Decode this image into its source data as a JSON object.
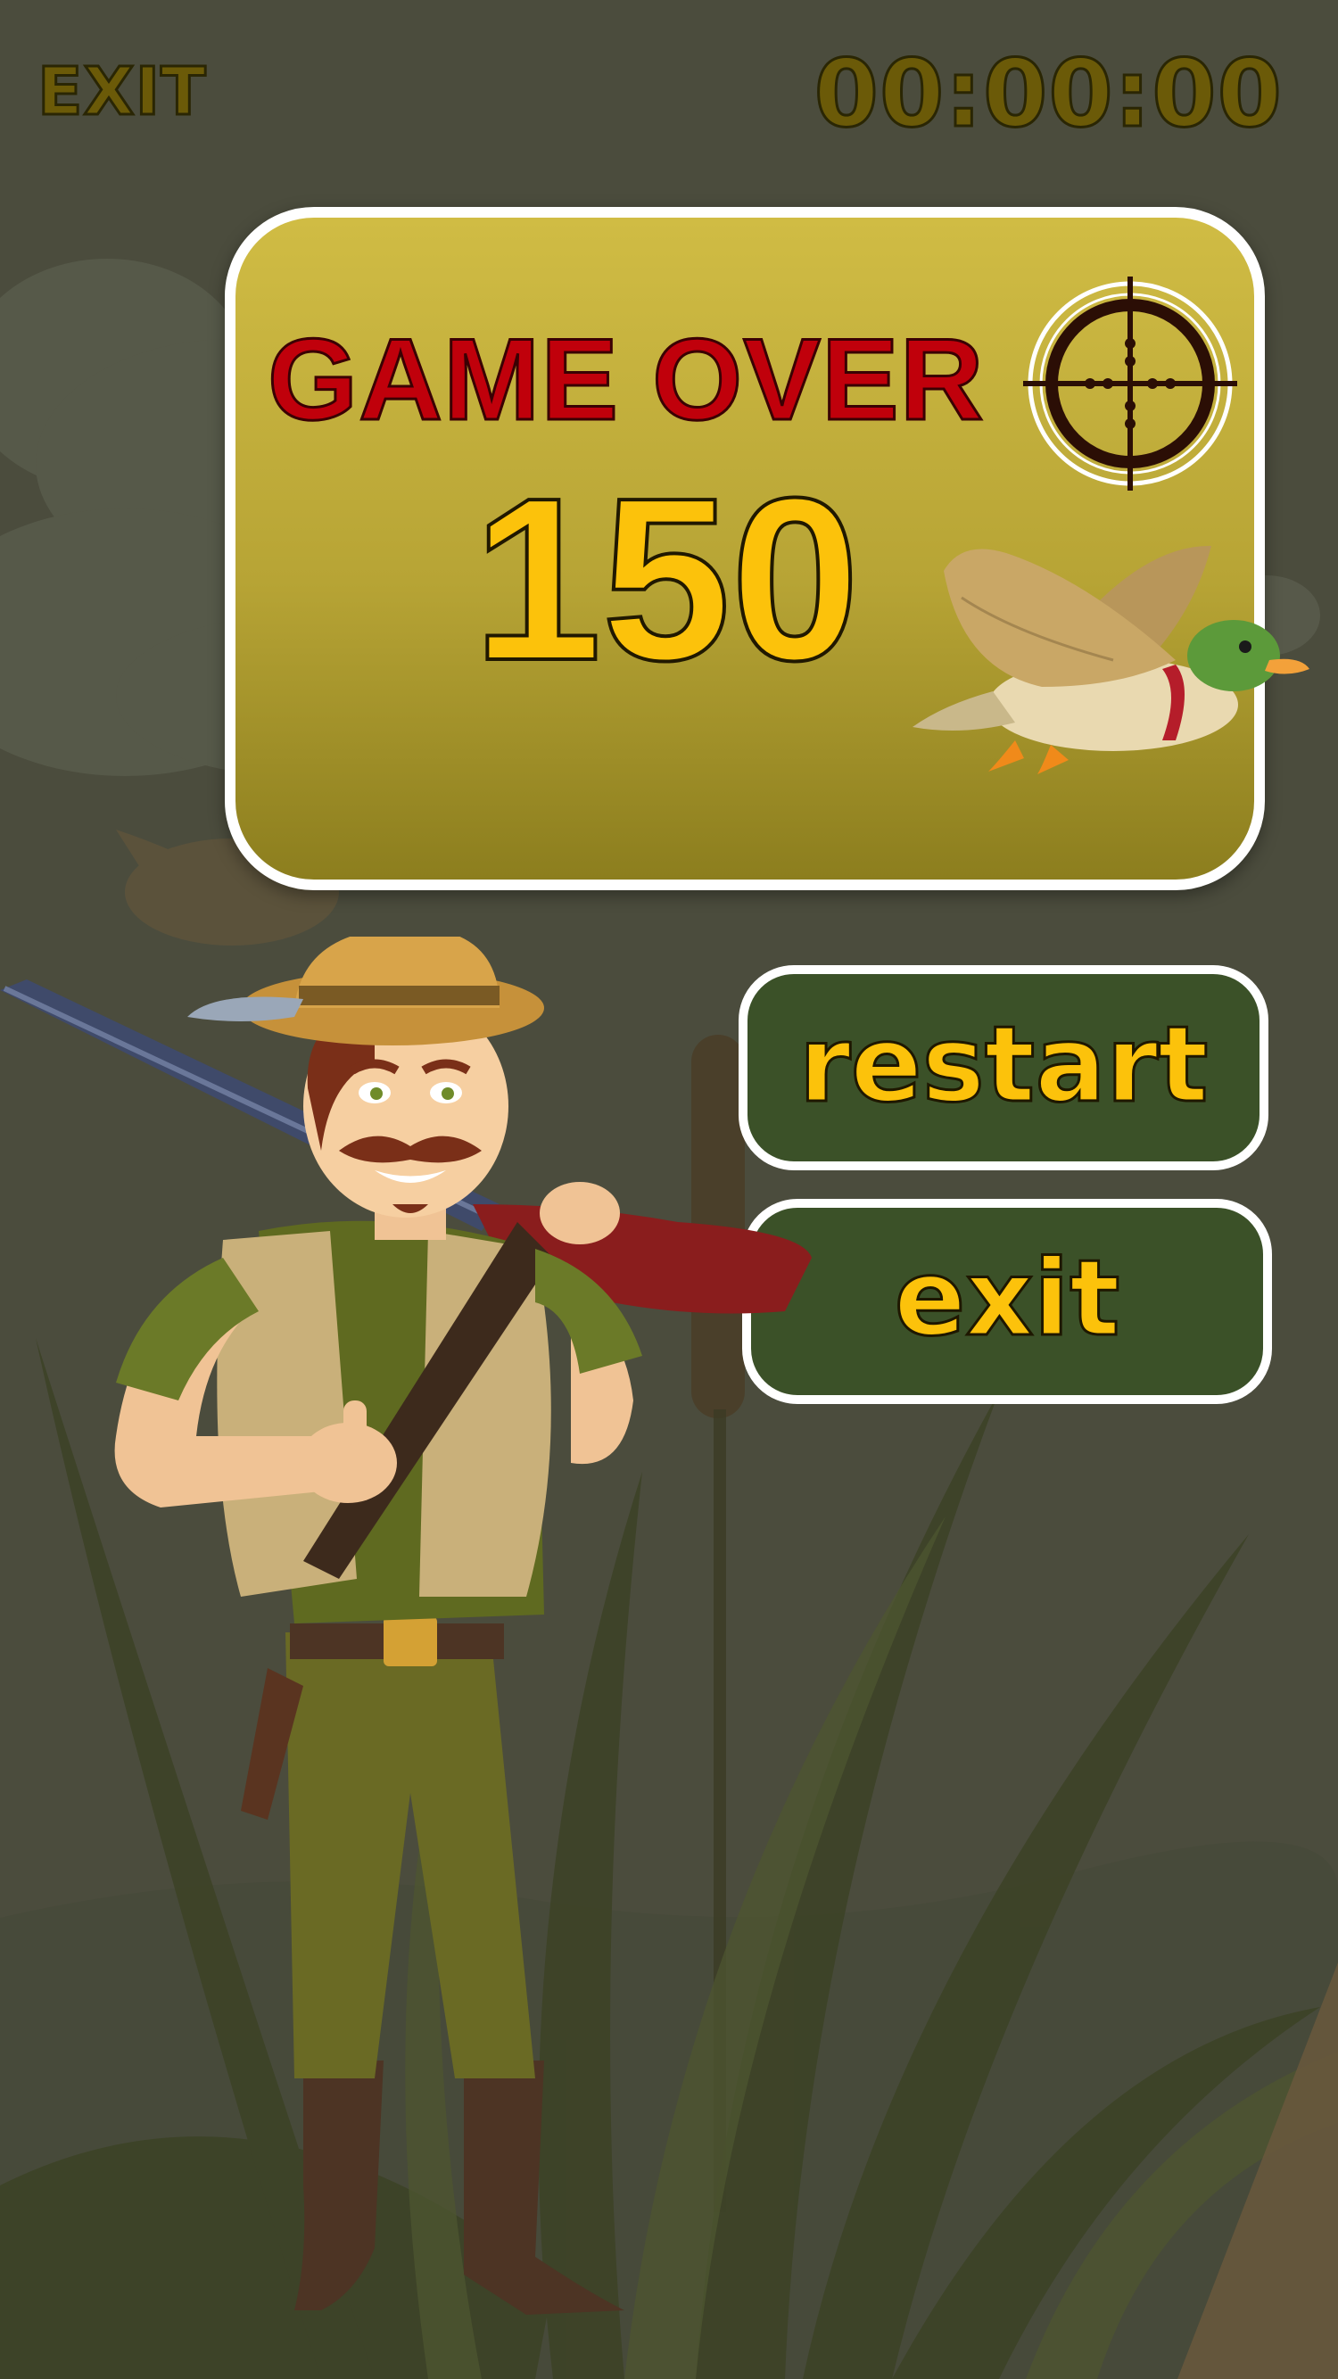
{
  "hud": {
    "exit_label": "EXIT",
    "timer": "00:00:00"
  },
  "game_over": {
    "title": "GAME OVER",
    "score": "150"
  },
  "menu": {
    "restart_label": "restart",
    "exit_label": "exit"
  },
  "icons": {
    "crosshair": "crosshair-icon",
    "duck": "flying-duck-illustration",
    "hunter": "hunter-character-illustration"
  },
  "colors": {
    "background": "#4b4c3d",
    "panel_top": "#d0bc44",
    "panel_bottom": "#8c7e1e",
    "title_red": "#c0000b",
    "score_yellow": "#fcc20b",
    "button_green": "#3b5128"
  }
}
